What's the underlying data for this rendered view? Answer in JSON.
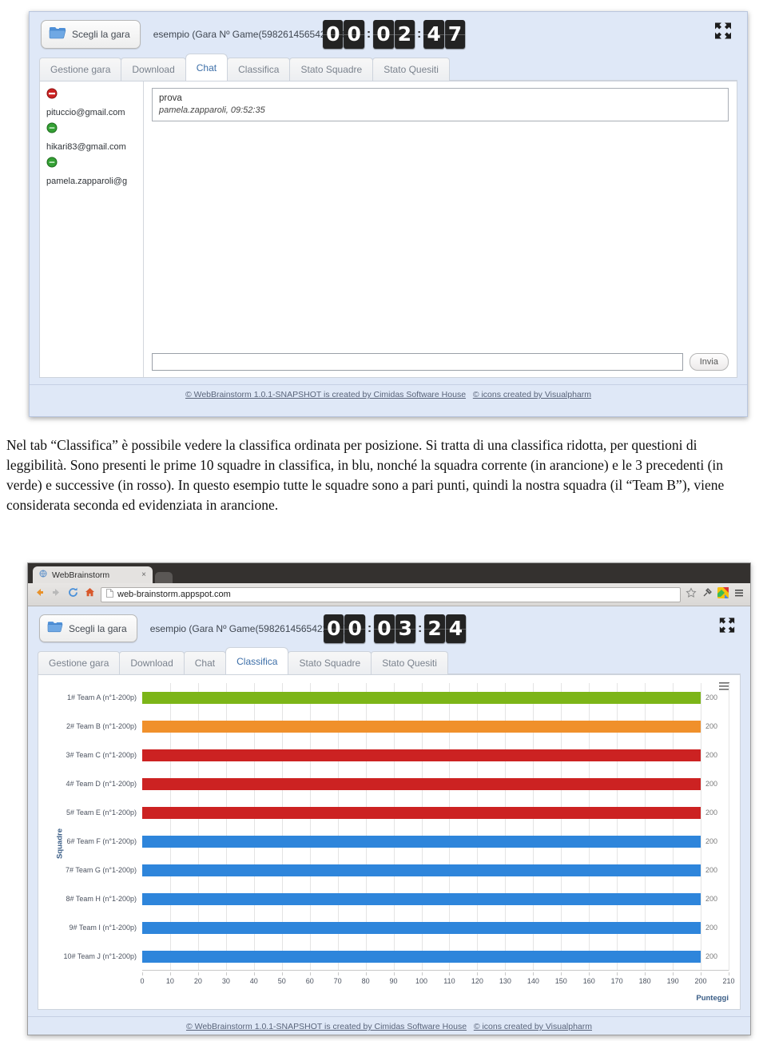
{
  "screenshot1": {
    "toolbar": {
      "choose_game_button": "Scegli la gara",
      "game_title": "esempio (Gara Nº Game(5982614565421056))",
      "folder_icon": "folder-icon",
      "fullscreen_icon": "fullscreen-icon",
      "timer": {
        "h1": "0",
        "h2": "0",
        "m1": "0",
        "m2": "2",
        "s1": "4",
        "s2": "7",
        "display": "00:02:47"
      }
    },
    "tabs": [
      {
        "label": "Gestione gara",
        "active": false
      },
      {
        "label": "Download",
        "active": false
      },
      {
        "label": "Chat",
        "active": true
      },
      {
        "label": "Classifica",
        "active": false
      },
      {
        "label": "Stato Squadre",
        "active": false
      },
      {
        "label": "Stato Quesiti",
        "active": false
      }
    ],
    "chat": {
      "users": [
        {
          "email": "pituccio@gmail.com",
          "status": "busy",
          "status_color": "#cc2222"
        },
        {
          "email": "hikari83@gmail.com",
          "status": "online",
          "status_color": "#2f9e2f"
        },
        {
          "email": "pamela.zapparoli@g",
          "status": "online",
          "status_color": "#2f9e2f"
        }
      ],
      "messages": [
        {
          "text": "prova",
          "meta": "pamela.zapparoli, 09:52:35"
        }
      ],
      "input_value": "",
      "input_placeholder": "",
      "send_button": "Invia"
    },
    "footer": {
      "credit_app": "© WebBrainstorm 1.0.1-SNAPSHOT is created by Cimidas Software House",
      "credit_icons": "© icons created by Visualpharm"
    }
  },
  "caption": {
    "text": "Nel tab “Classifica” è possibile vedere la classifica ordinata per posizione. Si tratta di una classifica ridotta, per questioni di leggibilità. Sono presenti le prime 10 squadre in classifica, in blu, nonché la squadra corrente (in arancione) e le 3 precedenti (in verde) e successive (in rosso). In questo esempio tutte le squadre sono a pari punti, quindi la nostra squadra (il “Team B”), viene considerata seconda ed evidenziata in arancione."
  },
  "screenshot2": {
    "browser": {
      "tab_title": "WebBrainstorm",
      "tab_close": "×",
      "url": "web-brainstorm.appspot.com",
      "back_icon": "back-arrow-icon",
      "forward_icon": "forward-arrow-icon",
      "reload_icon": "reload-icon",
      "home_icon": "home-icon",
      "page_icon": "page-icon",
      "bookmark_icon": "star-icon",
      "extension_icon": "extension-icon",
      "chrome_app_icon": "chrome-colors-icon",
      "menu_icon": "hamburger-menu-icon"
    },
    "toolbar": {
      "choose_game_button": "Scegli la gara",
      "game_title": "esempio (Gara Nº Game(5982614565421056))",
      "folder_icon": "folder-icon",
      "fullscreen_icon": "fullscreen-icon",
      "timer": {
        "h1": "0",
        "h2": "0",
        "m1": "0",
        "m2": "3",
        "s1": "2",
        "s2": "4",
        "display": "00:03:24"
      }
    },
    "tabs": [
      {
        "label": "Gestione gara",
        "active": false
      },
      {
        "label": "Download",
        "active": false
      },
      {
        "label": "Chat",
        "active": false
      },
      {
        "label": "Classifica",
        "active": true
      },
      {
        "label": "Stato Squadre",
        "active": false
      },
      {
        "label": "Stato Quesiti",
        "active": false
      }
    ],
    "chart_menu_icon": "chart-context-menu-icon",
    "footer": {
      "credit_app": "© WebBrainstorm 1.0.1-SNAPSHOT is created by Cimidas Software House",
      "credit_icons": "© icons created by Visualpharm"
    }
  },
  "chart_data": {
    "type": "bar",
    "title": "",
    "xlabel": "Punteggi",
    "ylabel": "Squadre",
    "xlim": [
      0,
      210
    ],
    "xticks": [
      0,
      10,
      20,
      30,
      40,
      50,
      60,
      70,
      80,
      90,
      100,
      110,
      120,
      130,
      140,
      150,
      160,
      170,
      180,
      190,
      200,
      210
    ],
    "grid": true,
    "legend": "none",
    "orientation": "horizontal",
    "categories": [
      "1# Team A (n°1-200p)",
      "2# Team B (n°1-200p)",
      "3# Team C (n°1-200p)",
      "4# Team D (n°1-200p)",
      "5# Team E (n°1-200p)",
      "6# Team F (n°1-200p)",
      "7# Team G (n°1-200p)",
      "8# Team H (n°1-200p)",
      "9# Team I (n°1-200p)",
      "10# Team J (n°1-200p)"
    ],
    "values": [
      200,
      200,
      200,
      200,
      200,
      200,
      200,
      200,
      200,
      200
    ],
    "data_labels": [
      "200",
      "200",
      "200",
      "200",
      "200",
      "200",
      "200",
      "200",
      "200",
      "200"
    ],
    "colors": [
      "#7cb518",
      "#f0902b",
      "#cc2222",
      "#cc2222",
      "#cc2222",
      "#2e85db",
      "#2e85db",
      "#2e85db",
      "#2e85db",
      "#2e85db"
    ],
    "color_legend": {
      "green": "#7cb518",
      "orange": "#f0902b",
      "red": "#cc2222",
      "blue": "#2e85db"
    }
  }
}
